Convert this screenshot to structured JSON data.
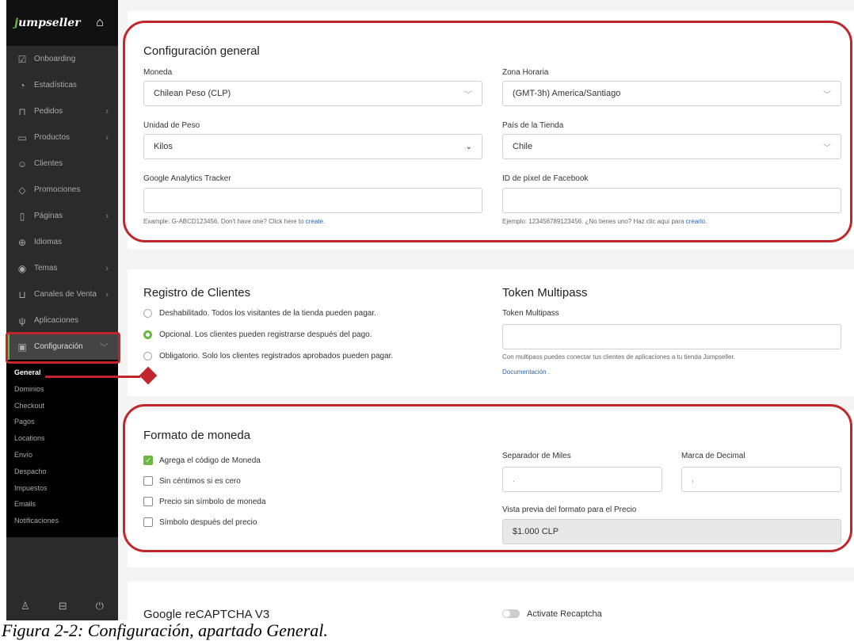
{
  "sidebar": {
    "brand_j": "j",
    "brand_rest": "umpseller",
    "items": [
      {
        "icon": "checkbox-icon",
        "glyph": "☑",
        "label": "Onboarding",
        "chevron": false
      },
      {
        "icon": "chart-icon",
        "glyph": "◔",
        "label": "Estadísticas",
        "chevron": false
      },
      {
        "icon": "basket-icon",
        "glyph": "⊓",
        "label": "Pedidos",
        "chevron": true
      },
      {
        "icon": "box-icon",
        "glyph": "▭",
        "label": "Productos",
        "chevron": true
      },
      {
        "icon": "users-icon",
        "glyph": "☺",
        "label": "Clientes",
        "chevron": false
      },
      {
        "icon": "tag-icon",
        "glyph": "◇",
        "label": "Promociones",
        "chevron": false
      },
      {
        "icon": "page-icon",
        "glyph": "▯",
        "label": "Páginas",
        "chevron": true
      },
      {
        "icon": "globe-icon",
        "glyph": "⊕",
        "label": "Idiomas",
        "chevron": false
      },
      {
        "icon": "eye-icon",
        "glyph": "◉",
        "label": "Temas",
        "chevron": true
      },
      {
        "icon": "cart-icon",
        "glyph": "⊔",
        "label": "Canales de Venta",
        "chevron": true
      },
      {
        "icon": "plug-icon",
        "glyph": "ψ",
        "label": "Aplicaciones",
        "chevron": false
      }
    ],
    "active": {
      "icon": "settings-icon",
      "glyph": "▣",
      "label": "Configuración",
      "chevron": "﹀"
    },
    "submenu": [
      "General",
      "Dominios",
      "Checkout",
      "Pagos",
      "Locations",
      "Envío",
      "Despacho",
      "Impuestos",
      "Emails",
      "Notificaciones"
    ],
    "footer": {
      "user": "♙",
      "briefcase": "⊟",
      "power": "⏻"
    }
  },
  "general": {
    "title": "Configuración general",
    "currency_label": "Moneda",
    "currency_value": "Chilean Peso (CLP)",
    "timezone_label": "Zona Horaria",
    "timezone_value": "(GMT-3h) America/Santiago",
    "weight_label": "Unidad de Peso",
    "weight_value": "Kilos",
    "country_label": "País de la Tienda",
    "country_value": "Chile",
    "ga_label": "Google Analytics Tracker",
    "ga_hint": "Example: G-ABCD123456. Don't have one? Click here to ",
    "ga_link": "create",
    "ga_hint_end": ".",
    "fb_label": "ID de píxel de Facebook",
    "fb_hint": "Ejemplo: 123456789123456. ¿No tienes uno? Haz clic aquí para ",
    "fb_link": "crearlo",
    "fb_hint_end": "."
  },
  "registration": {
    "title": "Registro de Clientes",
    "options": [
      "Deshabilitado. Todos los visitantes de la tienda pueden pagar.",
      "Opcional. Los clientes pueden registrarse después del pago.",
      "Obligatorio. Solo los clientes registrados aprobados pueden pagar."
    ],
    "selected": 1
  },
  "multipass": {
    "title": "Token Multipass",
    "label": "Token Multipass",
    "hint": "Con multipass puedes conectar tus clientes de aplicaciones a tu tienda Jumpseller.",
    "link": "Documentación",
    "link_end": " ."
  },
  "currency_format": {
    "title": "Formato de moneda",
    "checkboxes": [
      {
        "label": "Agrega el código de Moneda",
        "checked": true
      },
      {
        "label": "Sin céntimos si es cero",
        "checked": false
      },
      {
        "label": "Precio sin símbolo de moneda",
        "checked": false
      },
      {
        "label": "Símbolo después del precio",
        "checked": false
      }
    ],
    "thousands_label": "Separador de Miles",
    "thousands_value": ".",
    "decimal_label": "Marca de Decimal",
    "decimal_value": ",",
    "preview_label": "Vista previa del formato para el Precio",
    "preview_value": "$1.000 CLP"
  },
  "recaptcha": {
    "title": "Google reCAPTCHA V3",
    "toggle_label": "Activate Recaptcha"
  },
  "caption": "Figura 2-2: Configuración, apartado General.",
  "colors": {
    "accent": "#6ab83f",
    "highlight": "#c0262c",
    "sidebar": "#2b2b2b"
  }
}
